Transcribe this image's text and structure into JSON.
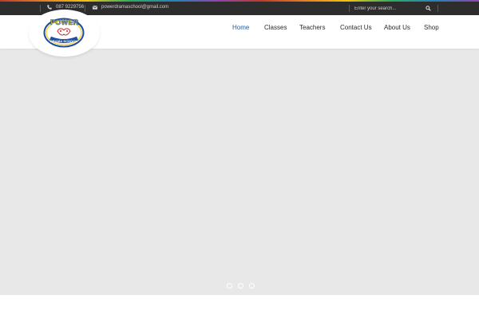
{
  "topbar": {
    "phone": "087 9229756",
    "email": "powerdramaschool@gmail.com",
    "search_placeholder": "Enter your search..."
  },
  "logo": {
    "top_text": "POWER",
    "bottom_text": "DRAMA SCHOOL"
  },
  "nav": {
    "items": [
      {
        "label": "Home",
        "active": true
      },
      {
        "label": "Classes"
      },
      {
        "label": "Teachers"
      },
      {
        "label": "Contact Us"
      },
      {
        "label": "About Us"
      },
      {
        "label": "Shop"
      }
    ]
  },
  "slider": {
    "dot_count": 3,
    "background": "#e8e8e8"
  },
  "colors": {
    "topbar_bg": "#2d2d2d",
    "nav_active": "#1e5a9c",
    "nav_text": "#2b2b2b"
  },
  "icons": [
    "phone-icon",
    "envelope-icon",
    "search-icon"
  ]
}
